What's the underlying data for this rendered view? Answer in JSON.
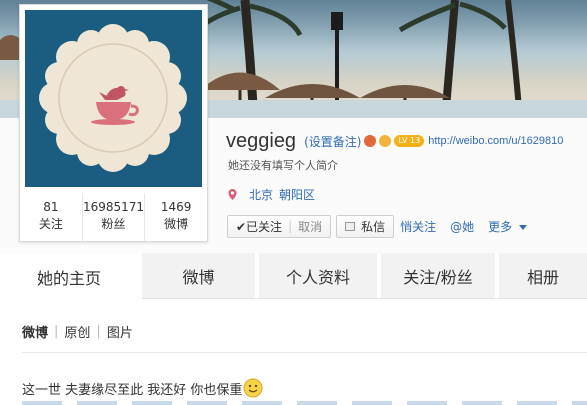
{
  "profile": {
    "username": "veggieg",
    "remark_link": "(设置备注)",
    "level_badge": "LV 13",
    "url": "http://weibo.com/u/1629810",
    "intro": "她还没有填写个人简介",
    "location": [
      "北京",
      "朝阳区"
    ],
    "stats": [
      {
        "value": "81",
        "label": "关注"
      },
      {
        "value": "16985171",
        "label": "粉丝"
      },
      {
        "value": "1469",
        "label": "微博"
      }
    ]
  },
  "actions": {
    "followed_label": "✔已关注",
    "unfollow_label": "取消",
    "message_label": "私信",
    "secret_follow": "悄关注",
    "mention": "@她",
    "more": "更多"
  },
  "tabs": [
    {
      "label": "她的主页",
      "active": true
    },
    {
      "label": "微博",
      "active": false
    },
    {
      "label": "个人资料",
      "active": false
    },
    {
      "label": "关注/粉丝",
      "active": false
    },
    {
      "label": "相册",
      "active": false
    }
  ],
  "feed": {
    "filters": [
      "微博",
      "原创",
      "图片"
    ],
    "active_filter": "微博",
    "post_text": "这一世 夫妻缘尽至此 我还好 你也保重"
  },
  "colors": {
    "avatar_bg": "#1a5d80",
    "link": "#2f6cb5",
    "level_badge": "#f5b018"
  },
  "icons": {
    "location": "pin-icon",
    "message": "envelope-icon",
    "more": "chevron-down-icon",
    "emoticon": "smiley-icon"
  }
}
